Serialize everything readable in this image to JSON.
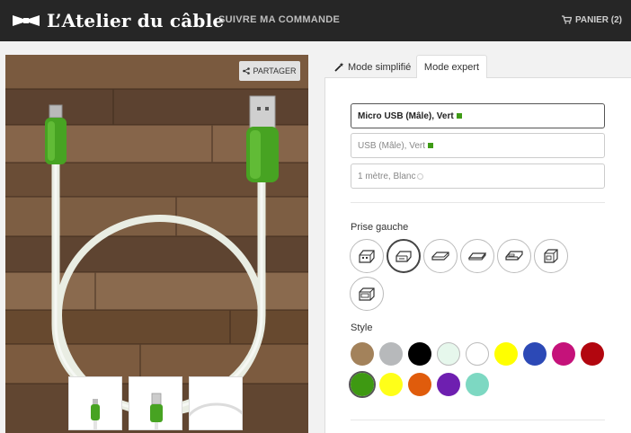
{
  "header": {
    "brand": "L’Atelier du câble",
    "nav_link": "SUIVRE MA COMMANDE",
    "cart_label": "PANIER (2)"
  },
  "product": {
    "share_label": "PARTAGER"
  },
  "tabs": {
    "simple": "Mode simplifié",
    "expert": "Mode expert"
  },
  "config": {
    "parts": [
      {
        "text": "Micro USB (Mâle), Vert",
        "indicator": "#3f9b16"
      },
      {
        "text": "USB (Mâle), Vert",
        "indicator": "#3f9b16"
      },
      {
        "text": "1 mètre, Blanc",
        "indicator": "#ffffff"
      }
    ],
    "connector_title": "Prise gauche",
    "connectors": [
      "usb-a-icon",
      "micro-usb-icon",
      "mini-usb-icon",
      "usb-c-icon",
      "lightning-icon",
      "usb-b-icon",
      "usb-a-female-icon"
    ],
    "style_title": "Style",
    "styles": [
      {
        "name": "brun",
        "color": "#a3825b"
      },
      {
        "name": "gris",
        "color": "#b7b9bb"
      },
      {
        "name": "noir",
        "color": "#000000"
      },
      {
        "name": "menthe",
        "color": "#e6f7ec"
      },
      {
        "name": "blanc",
        "color": "#ffffff"
      },
      {
        "name": "jaune",
        "color": "#ffff00"
      },
      {
        "name": "bleu",
        "color": "#2c49b6"
      },
      {
        "name": "magenta",
        "color": "#c5127a"
      },
      {
        "name": "rouge",
        "color": "#b2060f"
      },
      {
        "name": "vert",
        "color": "#3e9912",
        "selected": true
      },
      {
        "name": "jaune-citron",
        "color": "#ffff19"
      },
      {
        "name": "orange",
        "color": "#e05c0c"
      },
      {
        "name": "violet",
        "color": "#6e1fb0"
      },
      {
        "name": "turquoise",
        "color": "#7dd8c2"
      }
    ]
  }
}
